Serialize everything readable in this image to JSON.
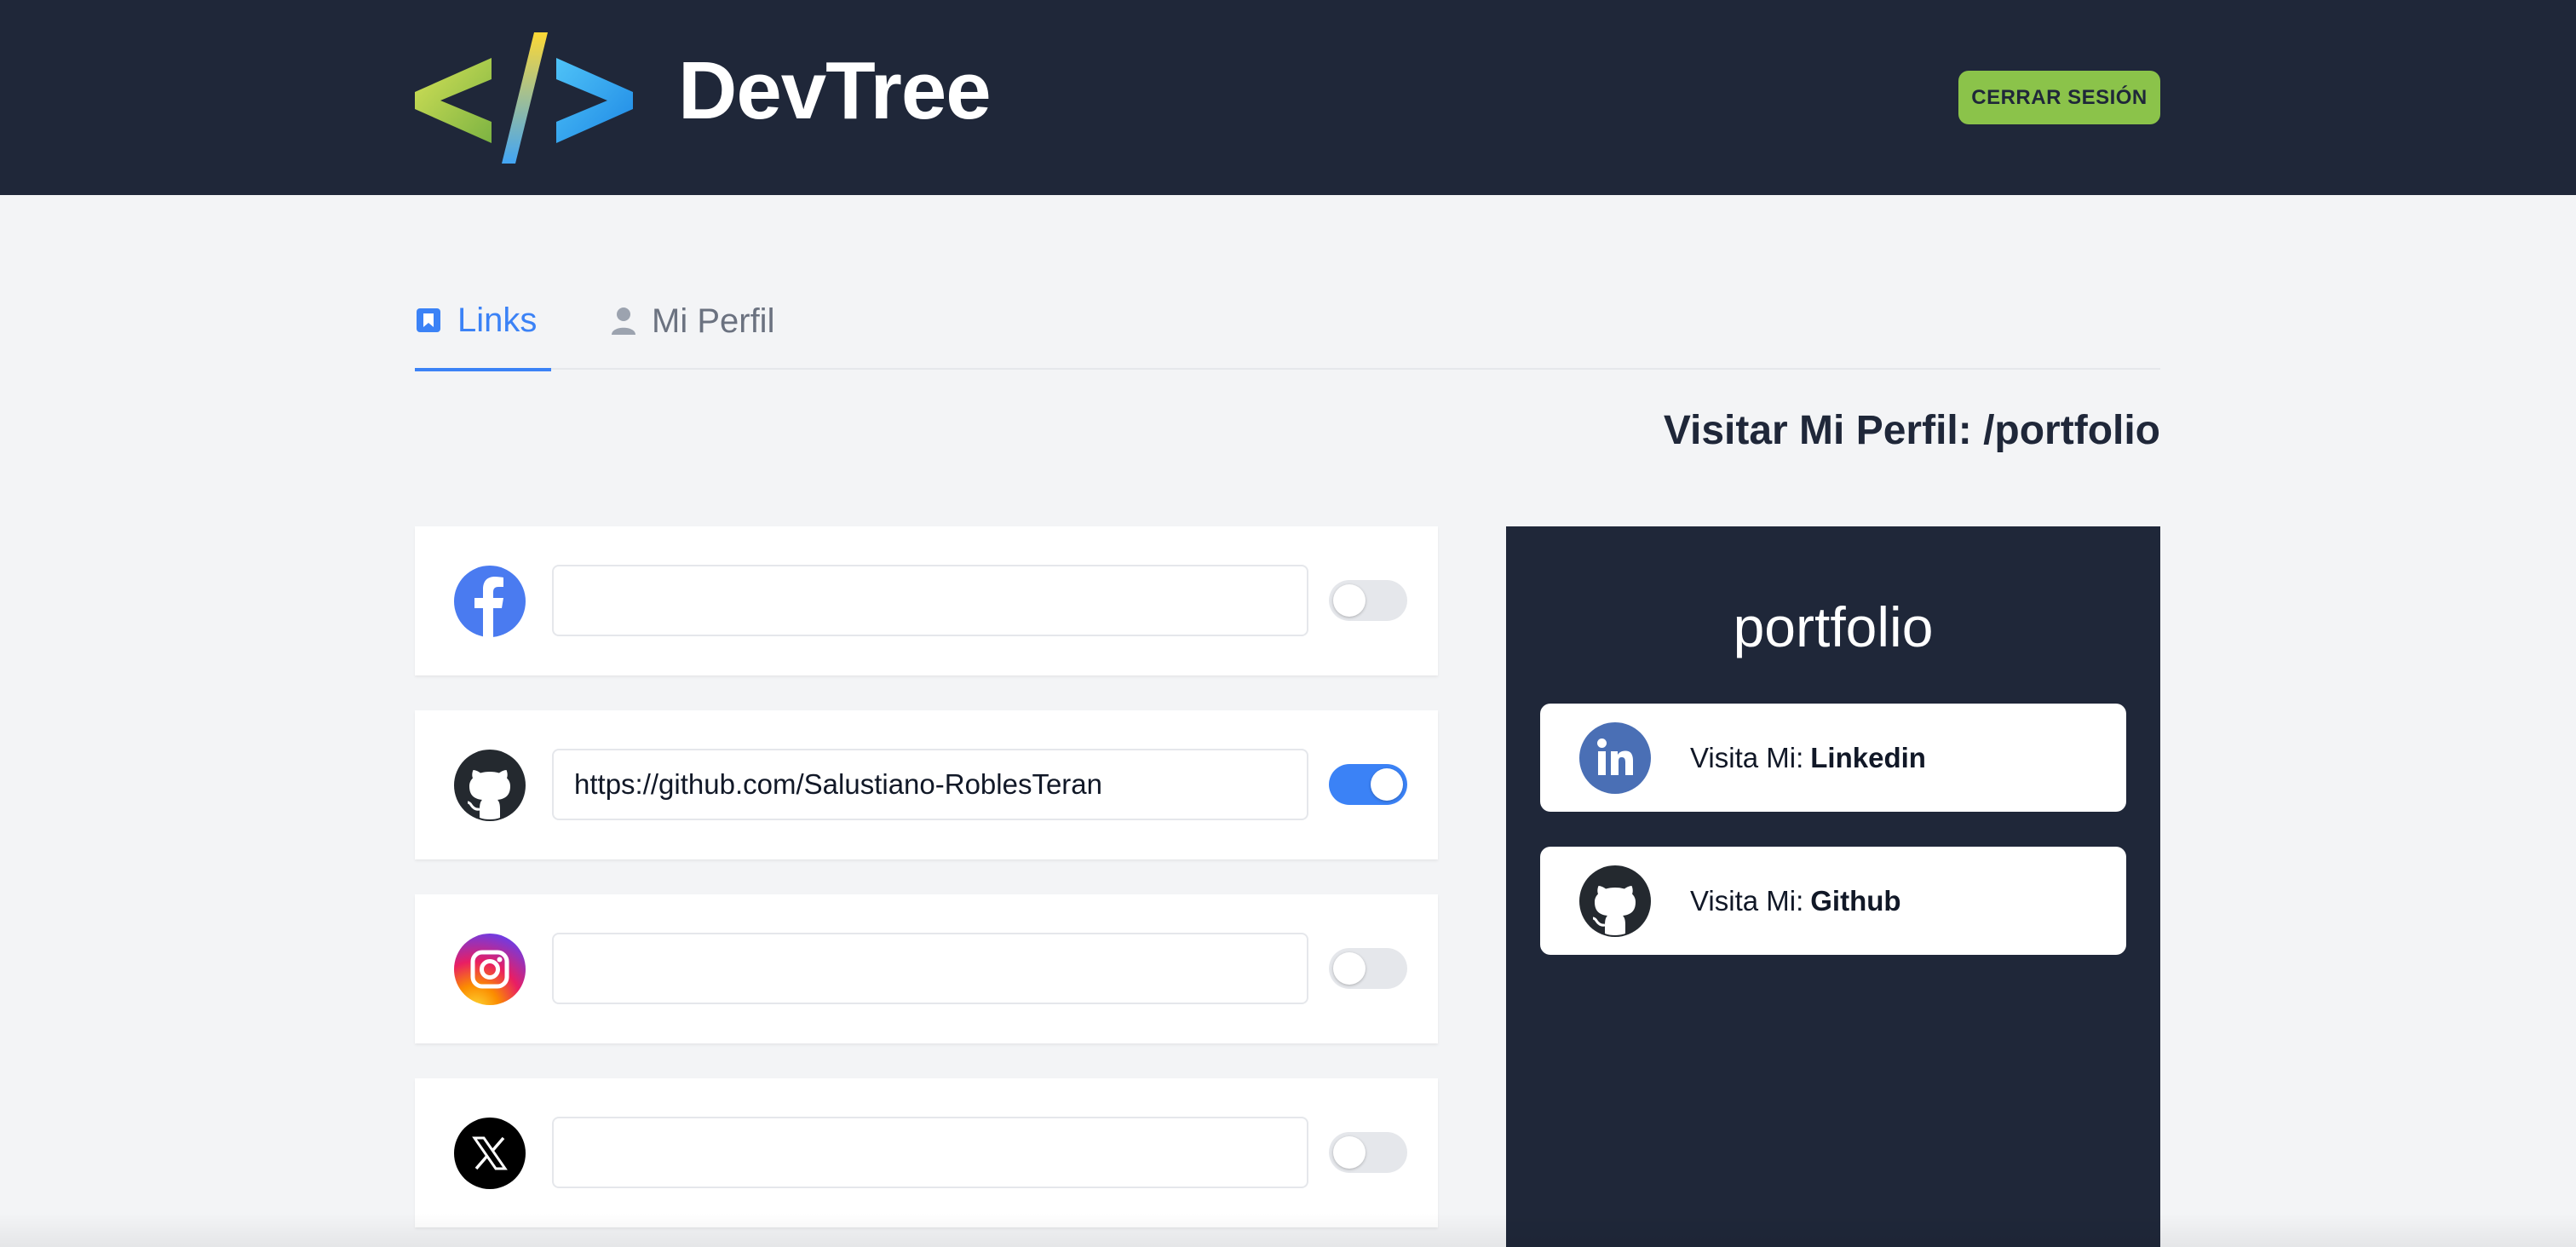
{
  "header": {
    "brand": "DevTree",
    "logo_icon": "code-brackets-logo",
    "logout_label": "CERRAR SESIÓN",
    "background": "#1f2739",
    "accent": "#8bc34a"
  },
  "tabs": [
    {
      "label": "Links",
      "icon": "bookmark-icon",
      "active": true
    },
    {
      "label": "Mi Perfil",
      "icon": "user-icon",
      "active": false
    }
  ],
  "visit_profile": "Visitar Mi Perfil: /portfolio",
  "social_links": [
    {
      "name": "facebook",
      "icon": "facebook-icon",
      "url": "",
      "enabled": false
    },
    {
      "name": "github",
      "icon": "github-icon",
      "url": "https://github.com/Salustiano-RoblesTeran",
      "enabled": true
    },
    {
      "name": "instagram",
      "icon": "instagram-icon",
      "url": "",
      "enabled": false
    },
    {
      "name": "x",
      "icon": "x-icon",
      "url": "",
      "enabled": false
    }
  ],
  "preview": {
    "handle": "portfolio",
    "links": [
      {
        "prefix": "Visita Mi:",
        "name": "Linkedin",
        "icon": "linkedin-icon"
      },
      {
        "prefix": "Visita Mi:",
        "name": "Github",
        "icon": "github-icon"
      }
    ]
  },
  "colors": {
    "primary": "#3b82f6",
    "page_bg": "#f3f4f6",
    "dark": "#1f2739"
  }
}
